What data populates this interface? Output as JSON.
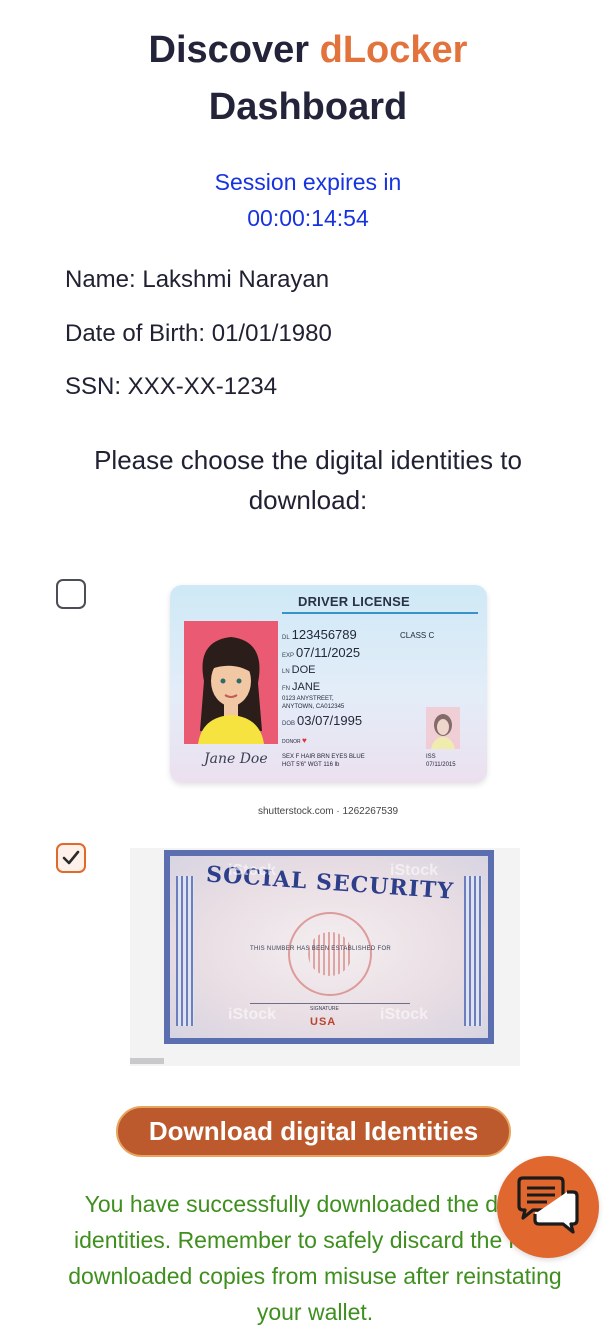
{
  "header": {
    "title_prefix": "Discover ",
    "title_brand": "dLocker",
    "title_suffix": "Dashboard"
  },
  "session": {
    "label": "Session expires in",
    "time": "00:00:14:54"
  },
  "user": {
    "name": "Name: Lakshmi Narayan",
    "dob": "Date of Birth: 01/01/1980",
    "ssn": "SSN: XXX-XX-1234"
  },
  "prompt": "Please choose the digital identities to download:",
  "identities": [
    {
      "checked": false,
      "card": {
        "title": "DRIVER LICENSE",
        "dl_label": "DL",
        "dl_number": "123456789",
        "class": "CLASS C",
        "exp_label": "EXP",
        "exp": "07/11/2025",
        "ln_label": "LN",
        "last_name": "DOE",
        "fn_label": "FN",
        "first_name": "JANE",
        "address_1": "0123 ANYSTREET,",
        "address_2": "ANYTOWN, CA012345",
        "dob_label": "DOB",
        "dob": "03/07/1995",
        "donor": "DONOR",
        "physical_1": "SEX F     HAIR BRN     EYES BLUE",
        "physical_2": "HGT 5'6\"     WGT 116 lb",
        "iss_label": "ISS",
        "iss": "07/11/2015",
        "signature": "Jane Doe"
      },
      "caption": "shutterstock.com · 1262267539"
    },
    {
      "checked": true,
      "card": {
        "title": "SOCIAL SECURITY",
        "established": "THIS NUMBER HAS BEEN ESTABLISHED FOR",
        "signature_label": "SIGNATURE",
        "usa": "USA",
        "watermark": "iStock"
      }
    }
  ],
  "download_button": "Download digital Identities",
  "success_message": "You have successfully downloaded the digital identities. Remember to safely discard the local downloaded copies from misuse after reinstating your wallet.",
  "colors": {
    "brand": "#e2733c",
    "session": "#1733e0",
    "success": "#3f8f1f",
    "button": "#bd5a2d",
    "chat": "#e0672e"
  },
  "icons": {
    "chat": "chat-bubbles-icon",
    "checkmark": "checkmark-icon"
  }
}
